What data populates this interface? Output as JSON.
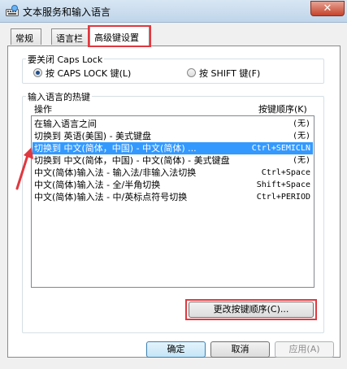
{
  "window": {
    "title": "文本服务和输入语言",
    "close_label": "✕"
  },
  "tabs": [
    {
      "label": "常规"
    },
    {
      "label": "语言栏"
    },
    {
      "label": "高级键设置"
    }
  ],
  "caps_lock_group": {
    "label": "要关闭 Caps Lock",
    "options": [
      {
        "label": "按 CAPS LOCK 键(L)",
        "selected": true
      },
      {
        "label": "按 SHIFT 键(F)",
        "selected": false
      }
    ]
  },
  "hotkeys_group": {
    "label": "输入语言的热键",
    "columns": {
      "action": "操作",
      "key_sequence": "按键顺序(K)"
    },
    "rows": [
      {
        "action": "在输入语言之间",
        "key": "(无)",
        "selected": false
      },
      {
        "action": "切换到 英语(美国) - 美式键盘",
        "key": "(无)",
        "selected": false
      },
      {
        "action": "切换到 中文(简体，中国) - 中文(简体) ...",
        "key": "Ctrl+SEMICLN",
        "selected": true
      },
      {
        "action": "切换到 中文(简体，中国) - 中文(简体) - 美式键盘",
        "key": "(无)",
        "selected": false
      },
      {
        "action": "中文(简体)输入法 - 输入法/非输入法切换",
        "key": "Ctrl+Space",
        "selected": false
      },
      {
        "action": "中文(简体)输入法 - 全/半角切换",
        "key": "Shift+Space",
        "selected": false
      },
      {
        "action": "中文(简体)输入法 - 中/英标点符号切换",
        "key": "Ctrl+PERIOD",
        "selected": false
      }
    ],
    "change_button": "更改按键顺序(C)..."
  },
  "footer": {
    "ok": "确定",
    "cancel": "取消",
    "apply": "应用(A)"
  },
  "colors": {
    "selection": "#3399ff",
    "annotation_red": "#e0383f"
  },
  "icons": {
    "app": "keyboard-globe-icon",
    "annotation": "red-arrow-icon"
  }
}
